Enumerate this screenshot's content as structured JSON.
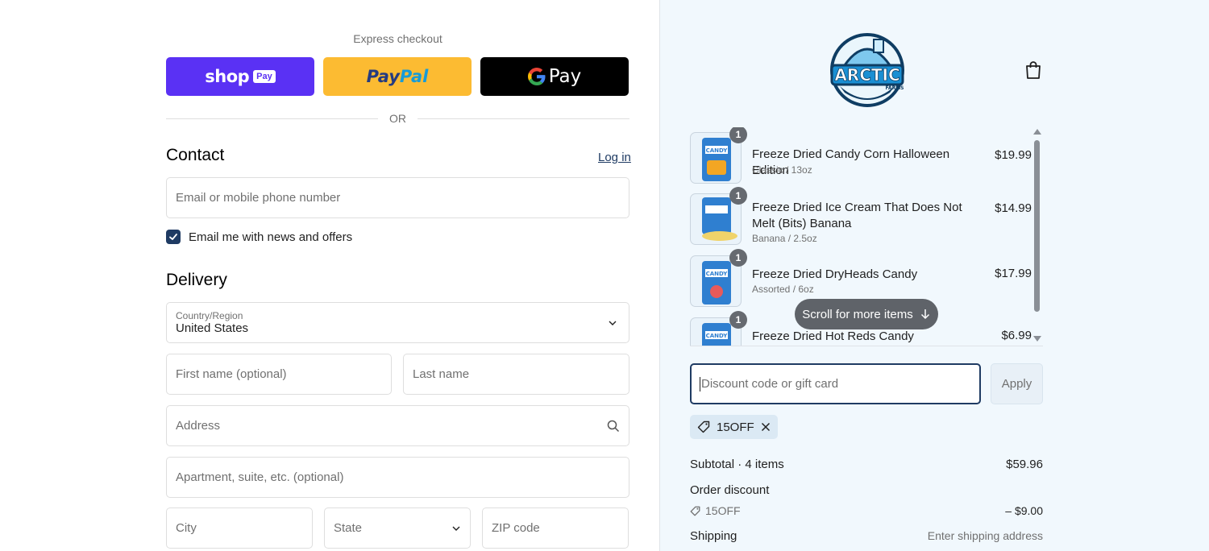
{
  "express": {
    "label": "Express checkout",
    "shop_pay": {
      "word": "shop",
      "pill": "Pay"
    },
    "paypal": {
      "part1": "Pay",
      "part2": "Pal"
    },
    "gpay": {
      "g": "G",
      "word": "Pay"
    },
    "or": "OR"
  },
  "contact": {
    "title": "Contact",
    "login": "Log in",
    "email_placeholder": "Email or mobile phone number",
    "newsletter_label": "Email me with news and offers",
    "newsletter_checked": true
  },
  "delivery": {
    "title": "Delivery",
    "country_label": "Country/Region",
    "country_value": "United States",
    "first_name": "First name (optional)",
    "last_name": "Last name",
    "address": "Address",
    "apartment": "Apartment, suite, etc. (optional)",
    "city": "City",
    "state": "State",
    "zip": "ZIP code"
  },
  "brand": {
    "name": "ARCTIC",
    "sub": "FARMS"
  },
  "items": [
    {
      "name": "Freeze Dried Candy Corn Halloween Edition",
      "variant": "Classic / 13oz",
      "price": "$19.99",
      "qty": "1"
    },
    {
      "name": "Freeze Dried Ice Cream That Does Not Melt (Bits) Banana",
      "variant": "Banana / 2.5oz",
      "price": "$14.99",
      "qty": "1"
    },
    {
      "name": "Freeze Dried DryHeads Candy",
      "variant": "Assorted / 6oz",
      "price": "$17.99",
      "qty": "1"
    },
    {
      "name": "Freeze Dried Hot Reds Candy",
      "variant": "",
      "price": "$6.99",
      "qty": "1"
    }
  ],
  "thumb_text": "CANDY",
  "scroll_hint": "Scroll for more items",
  "discount": {
    "placeholder": "Discount code or gift card",
    "apply": "Apply",
    "applied_code": "15OFF"
  },
  "summary": {
    "subtotal_label": "Subtotal · 4 items",
    "subtotal_value": "$59.96",
    "order_discount_label": "Order discount",
    "discount_code": "15OFF",
    "discount_value": "– $9.00",
    "shipping_label": "Shipping",
    "shipping_value": "Enter shipping address"
  },
  "colors": {
    "accent": "#1f3b63",
    "shop_pay": "#5a31f4",
    "paypal": "#fcbb32",
    "gpay": "#000000",
    "panel_bg": "#f1f8fd"
  }
}
